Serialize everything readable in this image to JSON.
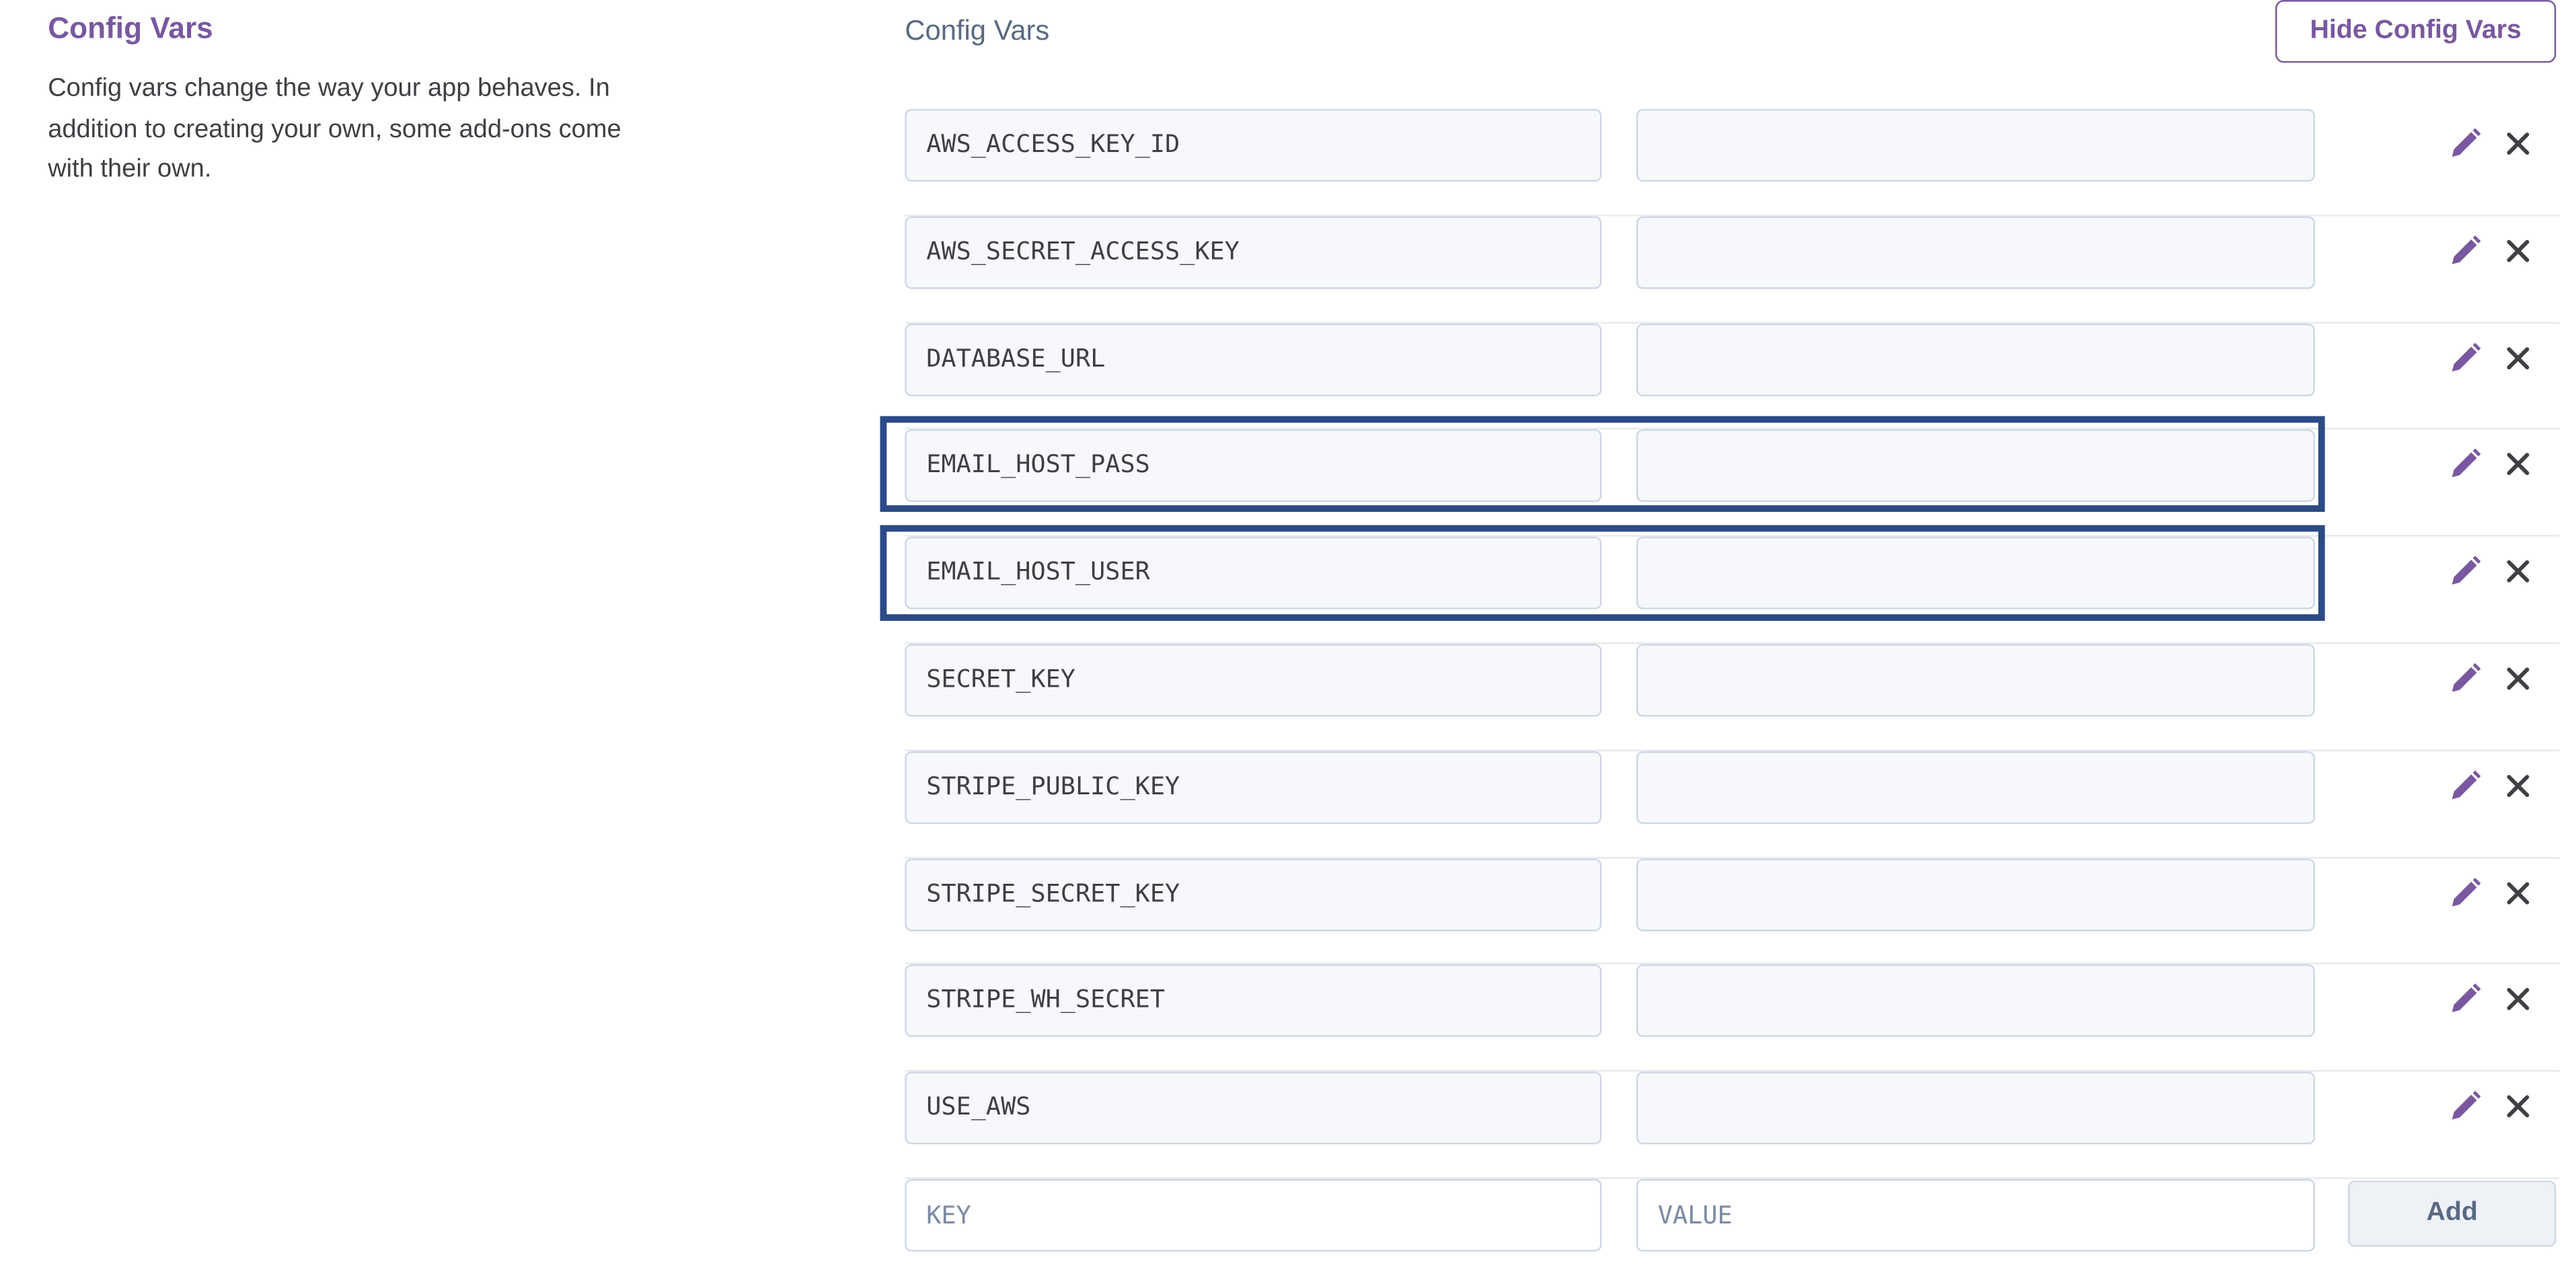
{
  "section": {
    "title": "Config Vars",
    "description": "Config vars change the way your app behaves. In addition to creating your own, some add-ons come with their own."
  },
  "panel": {
    "title": "Config Vars",
    "hide_button": "Hide Config Vars"
  },
  "vars": [
    {
      "key": "AWS_ACCESS_KEY_ID",
      "value": ""
    },
    {
      "key": "AWS_SECRET_ACCESS_KEY",
      "value": ""
    },
    {
      "key": "DATABASE_URL",
      "value": ""
    },
    {
      "key": "EMAIL_HOST_PASS",
      "value": ""
    },
    {
      "key": "EMAIL_HOST_USER",
      "value": ""
    },
    {
      "key": "SECRET_KEY",
      "value": ""
    },
    {
      "key": "STRIPE_PUBLIC_KEY",
      "value": ""
    },
    {
      "key": "STRIPE_SECRET_KEY",
      "value": ""
    },
    {
      "key": "STRIPE_WH_SECRET",
      "value": ""
    },
    {
      "key": "USE_AWS",
      "value": ""
    }
  ],
  "new_var": {
    "key_placeholder": "KEY",
    "value_placeholder": "VALUE",
    "add_button": "Add"
  },
  "icons": {
    "edit": "pencil-icon",
    "delete": "close-icon"
  },
  "colors": {
    "accent": "#79589f",
    "highlight": "#2c4a86"
  }
}
